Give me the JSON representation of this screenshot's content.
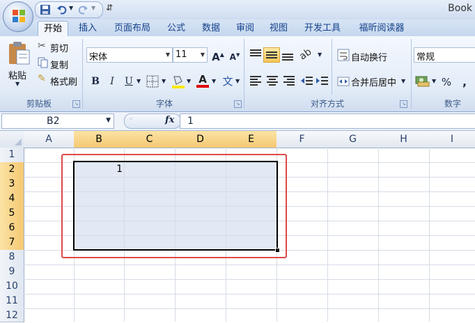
{
  "window": {
    "title": "Book"
  },
  "quick_access": {
    "save_icon": "save-icon",
    "undo_icon": "undo-icon",
    "redo_icon": "redo-icon",
    "customize_glyph": "⇵"
  },
  "tabs": [
    {
      "label": "开始",
      "active": true
    },
    {
      "label": "插入"
    },
    {
      "label": "页面布局"
    },
    {
      "label": "公式"
    },
    {
      "label": "数据"
    },
    {
      "label": "审阅"
    },
    {
      "label": "视图"
    },
    {
      "label": "开发工具"
    },
    {
      "label": "福昕阅读器"
    }
  ],
  "ribbon": {
    "clipboard": {
      "label": "剪贴板",
      "paste": "粘贴",
      "cut": "剪切",
      "copy": "复制",
      "format_painter": "格式刷"
    },
    "font": {
      "label": "字体",
      "font_name": "宋体",
      "font_size": "11",
      "bold": "B",
      "italic": "I",
      "underline": "U",
      "grow": "A",
      "shrink": "A",
      "font_color": "A",
      "phonetic": "文"
    },
    "alignment": {
      "label": "对齐方式",
      "wrap_text": "自动换行",
      "merge_center": "合并后居中"
    },
    "number": {
      "label": "数字",
      "format": "常规",
      "percent": "%",
      "comma": ","
    }
  },
  "formula_bar": {
    "name_box": "B2",
    "fx": "fx",
    "value": "1"
  },
  "grid": {
    "columns": [
      "A",
      "B",
      "C",
      "D",
      "E",
      "F",
      "G",
      "H",
      "I"
    ],
    "rows": [
      "1",
      "2",
      "3",
      "4",
      "5",
      "6",
      "7",
      "8",
      "9",
      "10",
      "11",
      "12"
    ],
    "cells": {
      "B2": "1"
    },
    "selected_columns": [
      "B",
      "C",
      "D",
      "E"
    ],
    "selected_rows": [
      "2",
      "3",
      "4",
      "5",
      "6",
      "7"
    ]
  },
  "colors": {
    "selection_border": "#000000",
    "annotation_red": "#e04848",
    "header_selected": "#f5c872"
  }
}
